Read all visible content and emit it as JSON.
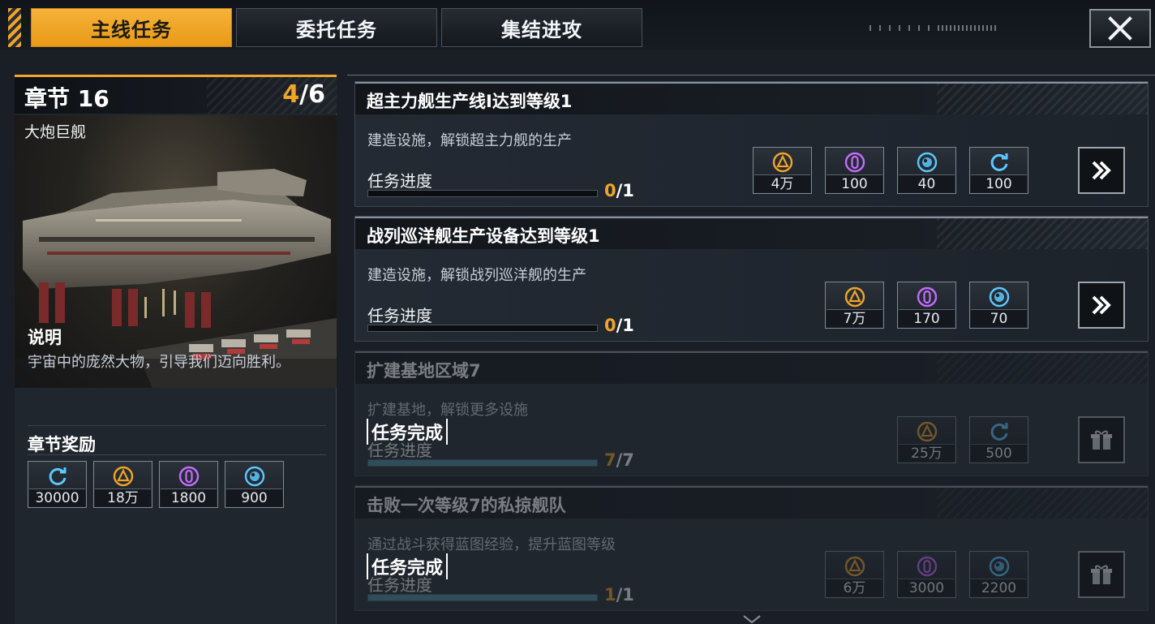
{
  "tabs": [
    {
      "label": "主线任务",
      "active": true
    },
    {
      "label": "委托任务",
      "active": false
    },
    {
      "label": "集结进攻",
      "active": false
    }
  ],
  "chapter": {
    "title": "章节 16",
    "progress_current": "4",
    "progress_total": "/6",
    "subtitle": "大炮巨舰",
    "desc_title": "说明",
    "desc_text": "宇宙中的庞然大物，引导我们迈向胜利。",
    "reward_title": "章节奖励",
    "rewards": [
      {
        "icon": "refresh-icon",
        "amount": "30000"
      },
      {
        "icon": "triangle-coin-icon",
        "amount": "18万"
      },
      {
        "icon": "crystal-icon",
        "amount": "1800"
      },
      {
        "icon": "energy-orb-icon",
        "amount": "900"
      }
    ]
  },
  "tasks": [
    {
      "name": "超主力舰生产线Ⅰ达到等级1",
      "desc": "建造设施，解锁超主力舰的生产",
      "progress_label": "任务进度",
      "progress_current": "0",
      "progress_total": "/1",
      "progress_fraction": 0.0,
      "done": false,
      "rewards": [
        {
          "icon": "triangle-coin-icon",
          "amount": "4万"
        },
        {
          "icon": "crystal-icon",
          "amount": "100"
        },
        {
          "icon": "energy-orb-icon",
          "amount": "40"
        },
        {
          "icon": "refresh-icon",
          "amount": "100"
        }
      ]
    },
    {
      "name": "战列巡洋舰生产设备达到等级1",
      "desc": "建造设施，解锁战列巡洋舰的生产",
      "progress_label": "任务进度",
      "progress_current": "0",
      "progress_total": "/1",
      "progress_fraction": 0.0,
      "done": false,
      "rewards": [
        {
          "icon": "triangle-coin-icon",
          "amount": "7万"
        },
        {
          "icon": "crystal-icon",
          "amount": "170"
        },
        {
          "icon": "energy-orb-icon",
          "amount": "70"
        }
      ]
    },
    {
      "name": "扩建基地区域7",
      "desc": "扩建基地，解锁更多设施",
      "progress_label": "任务进度",
      "progress_current": "7",
      "progress_total": "/7",
      "progress_fraction": 1.0,
      "done": true,
      "done_label": "任务完成",
      "rewards": [
        {
          "icon": "triangle-coin-icon",
          "amount": "25万"
        },
        {
          "icon": "refresh-icon",
          "amount": "500"
        }
      ]
    },
    {
      "name": "击败一次等级7的私掠舰队",
      "desc": "通过战斗获得蓝图经验，提升蓝图等级",
      "progress_label": "任务进度",
      "progress_current": "1",
      "progress_total": "/1",
      "progress_fraction": 1.0,
      "done": true,
      "done_label": "任务完成",
      "rewards": [
        {
          "icon": "triangle-coin-icon",
          "amount": "6万"
        },
        {
          "icon": "crystal-icon",
          "amount": "3000"
        },
        {
          "icon": "energy-orb-icon",
          "amount": "2200"
        }
      ]
    }
  ],
  "colors": {
    "accent": "#f0a52a",
    "crystal": "#c46cff",
    "energy": "#5cc8ff",
    "refresh": "#5cc8ff"
  }
}
